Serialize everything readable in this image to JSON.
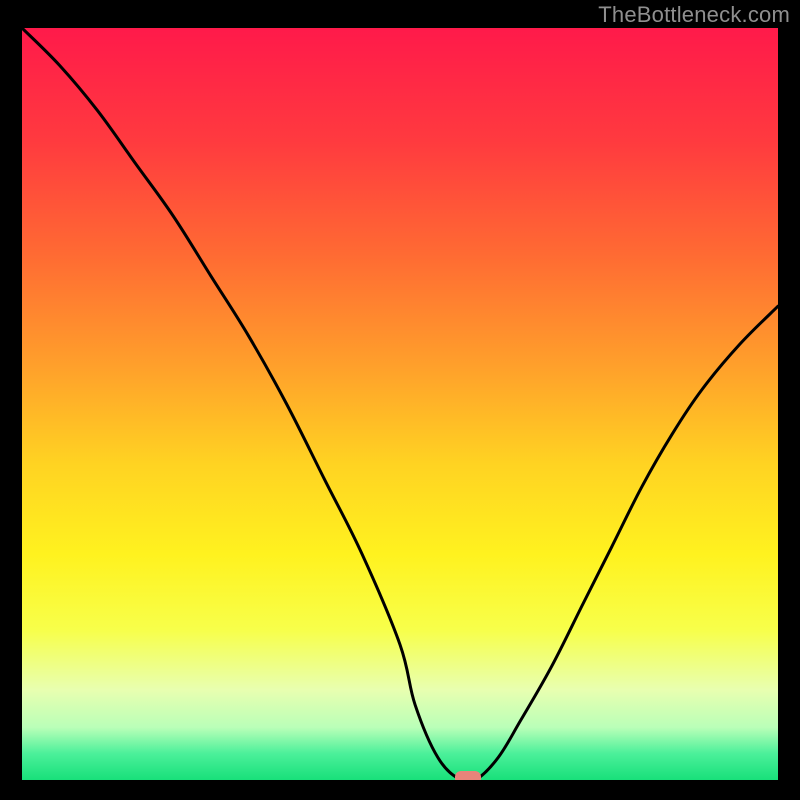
{
  "watermark": {
    "text": "TheBottleneck.com"
  },
  "chart_data": {
    "type": "line",
    "title": "",
    "xlabel": "",
    "ylabel": "",
    "xlim": [
      0,
      100
    ],
    "ylim": [
      0,
      100
    ],
    "grid": false,
    "background_gradient_stops": [
      {
        "offset": 0.0,
        "color": "#ff1a4a"
      },
      {
        "offset": 0.15,
        "color": "#ff3a3f"
      },
      {
        "offset": 0.3,
        "color": "#ff6a33"
      },
      {
        "offset": 0.45,
        "color": "#ffa02b"
      },
      {
        "offset": 0.58,
        "color": "#ffd322"
      },
      {
        "offset": 0.7,
        "color": "#fff21f"
      },
      {
        "offset": 0.8,
        "color": "#f7ff4a"
      },
      {
        "offset": 0.88,
        "color": "#e8ffb0"
      },
      {
        "offset": 0.93,
        "color": "#baffb8"
      },
      {
        "offset": 0.965,
        "color": "#4bf09a"
      },
      {
        "offset": 1.0,
        "color": "#18e07a"
      }
    ],
    "curve": {
      "description": "V-shaped bottleneck curve",
      "x": [
        0,
        5,
        10,
        15,
        20,
        25,
        30,
        35,
        40,
        45,
        50,
        52,
        55,
        58,
        60,
        63,
        66,
        70,
        74,
        78,
        82,
        86,
        90,
        95,
        100
      ],
      "y": [
        100,
        95,
        89,
        82,
        75,
        67,
        59,
        50,
        40,
        30,
        18,
        10,
        3,
        0,
        0,
        3,
        8,
        15,
        23,
        31,
        39,
        46,
        52,
        58,
        63
      ]
    },
    "marker": {
      "description": "pink lozenge marker at curve minimum",
      "x": 59,
      "y": 0,
      "color": "#e8847a"
    }
  }
}
